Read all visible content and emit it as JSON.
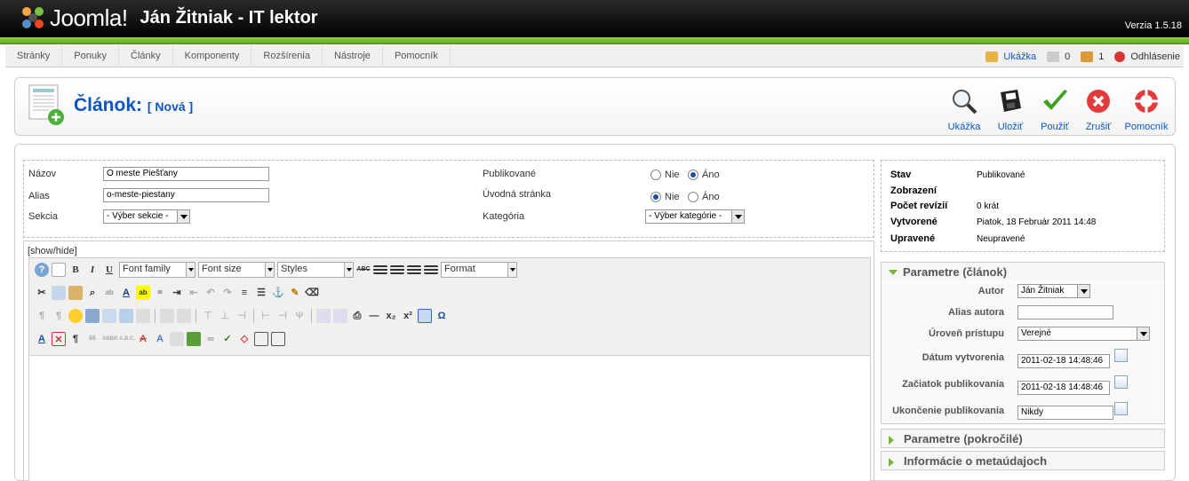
{
  "header": {
    "brand": "Joomla!",
    "site_name": "Ján Žitniak - IT lektor",
    "version": "Verzia 1.5.18"
  },
  "menu": [
    "Stránky",
    "Ponuky",
    "Články",
    "Komponenty",
    "Rozšírenia",
    "Nástroje",
    "Pomocník"
  ],
  "status": {
    "preview": "Ukážka",
    "messages": "0",
    "users": "1",
    "logout": "Odhlásenie"
  },
  "title": {
    "main": "Článok:",
    "sub": "[ Nová ]"
  },
  "toolbar": {
    "preview": "Ukážka",
    "save": "Uložiť",
    "apply": "Použiť",
    "cancel": "Zrušiť",
    "help": "Pomocník"
  },
  "form": {
    "title_label": "Názov",
    "title_value": "O meste Piešťany",
    "alias_label": "Alias",
    "alias_value": "o-meste-piestany",
    "section_label": "Sekcia",
    "section_value": "- Výber sekcie -",
    "published_label": "Publikované",
    "frontpage_label": "Úvodná stránka",
    "category_label": "Kategória",
    "category_value": "- Výber kategórie -",
    "no": "Nie",
    "yes": "Áno"
  },
  "editor": {
    "showhide": "[show/hide]",
    "font_family": "Font family",
    "font_size": "Font size",
    "styles": "Styles",
    "format": "Format"
  },
  "meta": {
    "state_label": "Stav",
    "state_value": "Publikované",
    "hits_label": "Zobrazení",
    "hits_value": "",
    "revisions_label": "Počet revízií",
    "revisions_value": "0 krát",
    "created_label": "Vytvorené",
    "created_value": "Piatok, 18 Február 2011 14:48",
    "modified_label": "Upravené",
    "modified_value": "Neupravené"
  },
  "params": {
    "panel_title": "Parametre (článok)",
    "author_label": "Autor",
    "author_value": "Ján Žitniak",
    "alias_label": "Alias autora",
    "alias_value": "",
    "access_label": "Úroveň prístupu",
    "access_value": "Verejné",
    "created_label": "Dátum vytvorenia",
    "created_value": "2011-02-18 14:48:46",
    "publish_up_label": "Začiatok publikovania",
    "publish_up_value": "2011-02-18 14:48:46",
    "publish_down_label": "Ukončenie publikovania",
    "publish_down_value": "Nikdy"
  },
  "panels": {
    "advanced": "Parametre (pokročilé)",
    "metadata": "Informácie o metaúdajoch"
  }
}
